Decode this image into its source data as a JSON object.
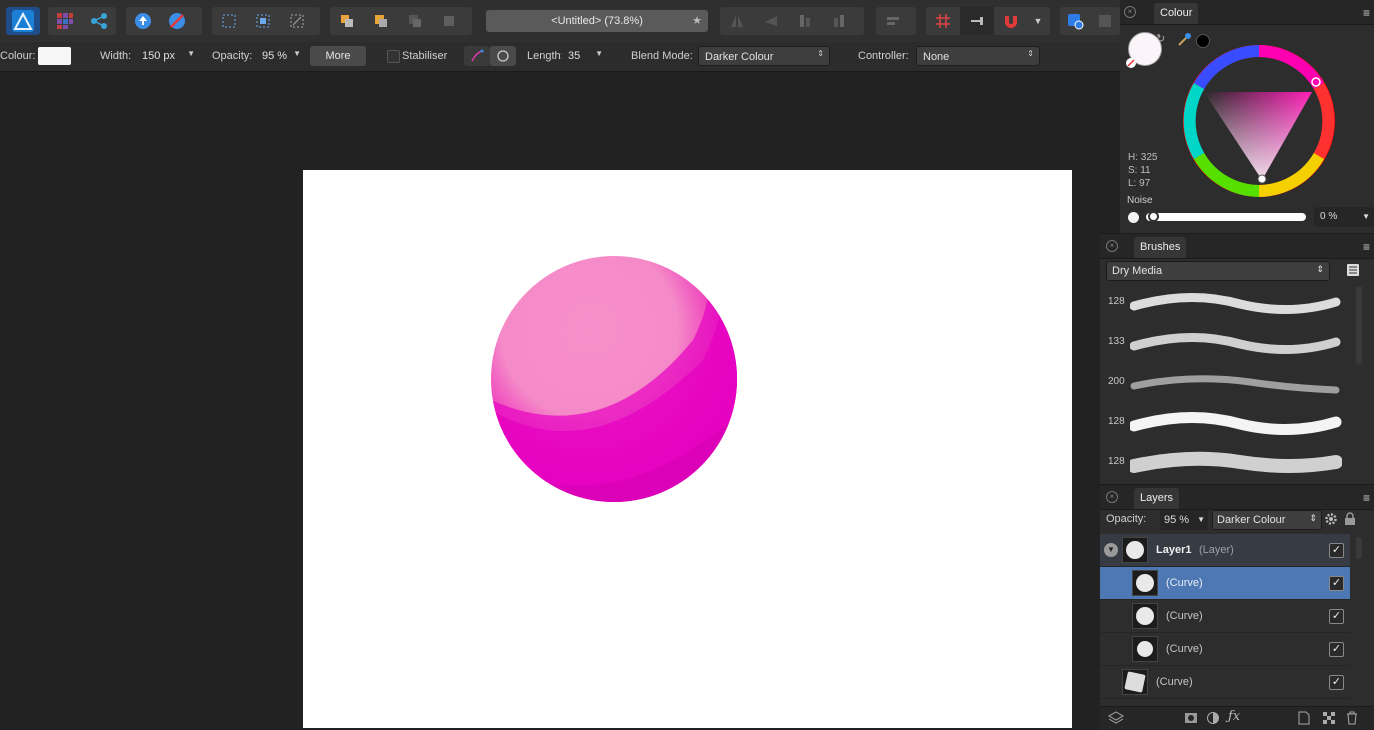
{
  "toolbar": {
    "doc_title": "<Untitled> (73.8%)",
    "doc_modified": "★"
  },
  "context_bar": {
    "colour_label": "Colour:",
    "width_label": "Width:",
    "width_value": "150 px",
    "opacity_label": "Opacity:",
    "opacity_value": "95 %",
    "more_label": "More",
    "stabiliser_label": "Stabiliser",
    "length_label": "Length:",
    "length_value": "35",
    "blend_label": "Blend Mode:",
    "blend_value": "Darker Colour",
    "controller_label": "Controller:",
    "controller_value": "None"
  },
  "colour_panel": {
    "title": "Colour",
    "h": "H: 325",
    "s": "S: 11",
    "l": "L: 97",
    "noise_label": "Noise",
    "noise_value": "0 %"
  },
  "brushes_panel": {
    "title": "Brushes",
    "category": "Dry Media",
    "brushes": [
      {
        "size": "128"
      },
      {
        "size": "133"
      },
      {
        "size": "200"
      },
      {
        "size": "128"
      },
      {
        "size": "128"
      }
    ]
  },
  "layers_panel": {
    "title": "Layers",
    "opacity_label": "Opacity:",
    "opacity_value": "95 %",
    "blend_value": "Darker Colour",
    "layers": [
      {
        "name": "Layer1",
        "type": "(Layer)"
      },
      {
        "name": "(Curve)"
      },
      {
        "name": "(Curve)"
      },
      {
        "name": "(Curve)"
      },
      {
        "name": "(Curve)"
      }
    ]
  },
  "colors": {
    "accent": "#4d78b3",
    "sphere_light": "#f68fcb",
    "sphere_dark": "#e600c0"
  }
}
